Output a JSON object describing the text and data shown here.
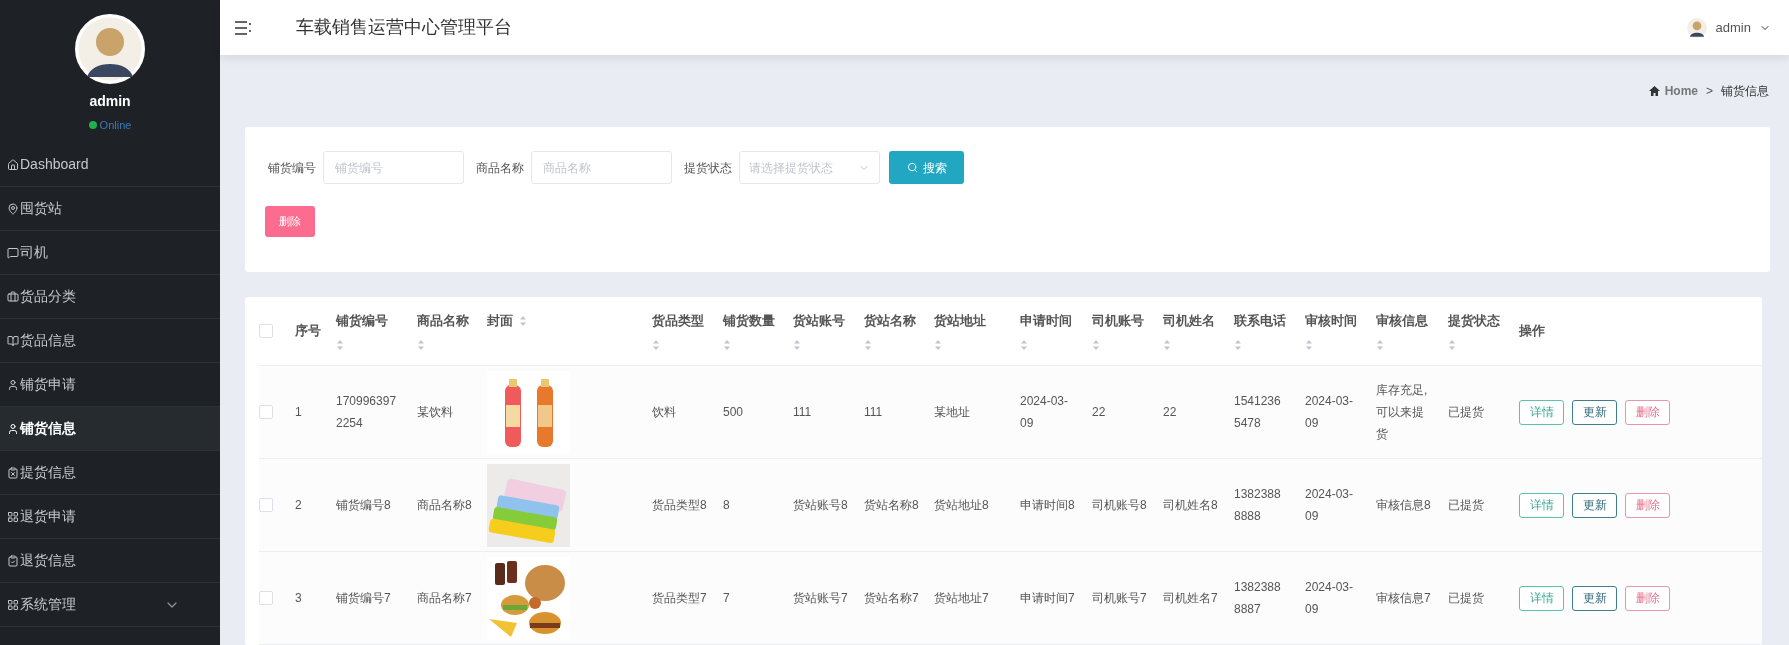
{
  "sidebar": {
    "user": {
      "name": "admin",
      "status": "Online"
    },
    "items": [
      {
        "label": "Dashboard",
        "selected": false,
        "kind": "link"
      },
      {
        "label": "囤货站",
        "selected": false,
        "kind": "link"
      },
      {
        "label": "司机",
        "selected": false,
        "kind": "link"
      },
      {
        "label": "货品分类",
        "selected": false,
        "kind": "link"
      },
      {
        "label": "货品信息",
        "selected": false,
        "kind": "link"
      },
      {
        "label": "铺货申请",
        "selected": false,
        "kind": "link"
      },
      {
        "label": "铺货信息",
        "selected": true,
        "kind": "link"
      },
      {
        "label": "提货信息",
        "selected": false,
        "kind": "link"
      },
      {
        "label": "退货申请",
        "selected": false,
        "kind": "link"
      },
      {
        "label": "退货信息",
        "selected": false,
        "kind": "link"
      },
      {
        "label": "系统管理",
        "selected": false,
        "kind": "group"
      }
    ]
  },
  "header": {
    "title": "车载销售运营中心管理平台",
    "user": "admin"
  },
  "breadcrumb": {
    "home": "Home",
    "separator": ">",
    "current": "铺货信息"
  },
  "search": {
    "fields": [
      {
        "label": "铺货编号",
        "placeholder": "铺货编号",
        "kind": "input"
      },
      {
        "label": "商品名称",
        "placeholder": "商品名称",
        "kind": "input"
      },
      {
        "label": "提货状态",
        "placeholder": "请选择提货状态",
        "kind": "select"
      }
    ],
    "button": "搜索",
    "delete_button": "删除"
  },
  "table": {
    "all_checked": false,
    "columns": [
      {
        "label": "序号",
        "sortable": false
      },
      {
        "label": "铺货编号",
        "sortable": true
      },
      {
        "label": "商品名称",
        "sortable": true
      },
      {
        "label": "封面",
        "sortable": true
      },
      {
        "label": "货品类型",
        "sortable": true
      },
      {
        "label": "铺货数量",
        "sortable": true
      },
      {
        "label": "货站账号",
        "sortable": true
      },
      {
        "label": "货站名称",
        "sortable": true
      },
      {
        "label": "货站地址",
        "sortable": true
      },
      {
        "label": "申请时间",
        "sortable": true
      },
      {
        "label": "司机账号",
        "sortable": true
      },
      {
        "label": "司机姓名",
        "sortable": true
      },
      {
        "label": "联系电话",
        "sortable": true
      },
      {
        "label": "审核时间",
        "sortable": true
      },
      {
        "label": "审核信息",
        "sortable": true
      },
      {
        "label": "提货状态",
        "sortable": true
      },
      {
        "label": "操作",
        "sortable": false
      }
    ],
    "rows": [
      {
        "checked": false,
        "cells": [
          "1",
          "1709963972254",
          "某饮料",
          {
            "kind": "picture"
          },
          "饮料",
          "500",
          "111",
          "111",
          "某地址",
          "2024-03-09",
          "22",
          "22",
          "15412365478",
          "2024-03-09",
          "库存充足,可以来提货",
          "已提货",
          [
            {
              "label": "详情",
              "kind": "detail"
            },
            {
              "label": "更新",
              "kind": "update"
            },
            {
              "label": "删除",
              "kind": "delete"
            }
          ]
        ]
      },
      {
        "checked": false,
        "cells": [
          "2",
          "铺货编号8",
          "商品名称8",
          {
            "kind": "picture"
          },
          "货品类型8",
          "8",
          "货站账号8",
          "货站名称8",
          "货站地址8",
          "申请时间8",
          "司机账号8",
          "司机姓名8",
          "13823888888",
          "2024-03-09",
          "审核信息8",
          "已提货",
          [
            {
              "label": "详情",
              "kind": "detail"
            },
            {
              "label": "更新",
              "kind": "update"
            },
            {
              "label": "删除",
              "kind": "delete"
            }
          ]
        ]
      },
      {
        "checked": false,
        "cells": [
          "3",
          "铺货编号7",
          "商品名称7",
          {
            "kind": "picture"
          },
          "货品类型7",
          "7",
          "货站账号7",
          "货站名称7",
          "货站地址7",
          "申请时间7",
          "司机账号7",
          "司机姓名7",
          "13823888887",
          "2024-03-09",
          "审核信息7",
          "已提货",
          [
            {
              "label": "详情",
              "kind": "detail"
            },
            {
              "label": "更新",
              "kind": "update"
            },
            {
              "label": "删除",
              "kind": "delete"
            }
          ]
        ]
      }
    ]
  }
}
